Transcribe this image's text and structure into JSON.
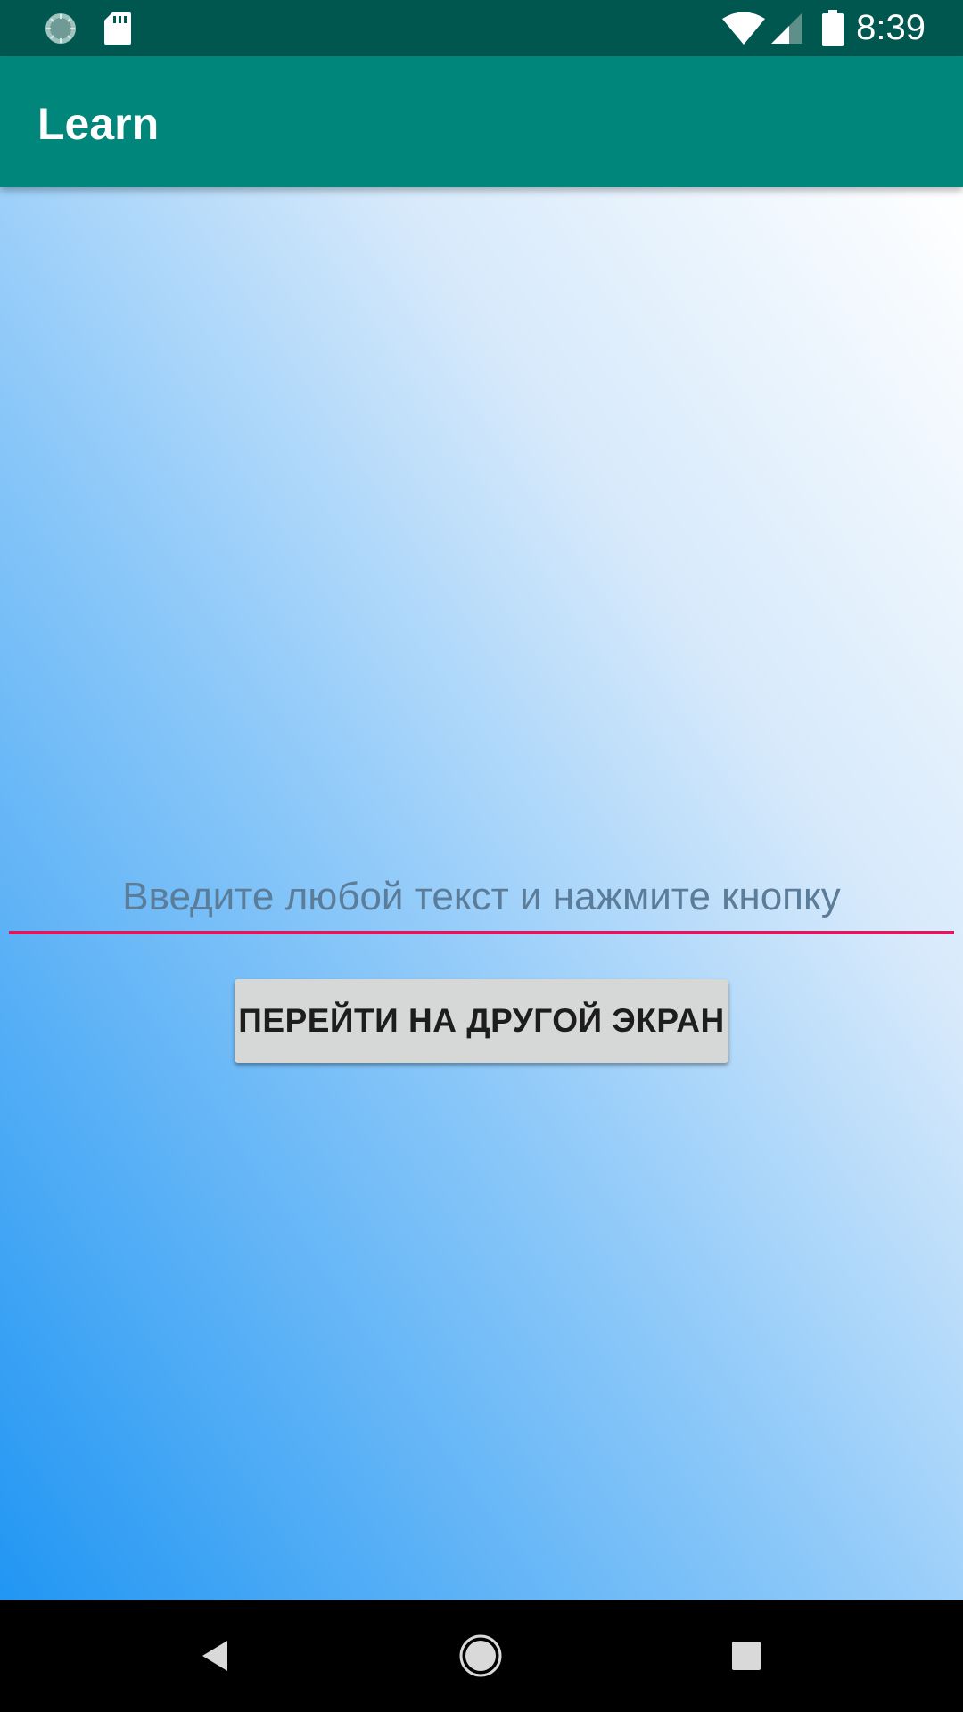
{
  "status_bar": {
    "time": "8:39",
    "left_icons": [
      "sync-icon",
      "sd-card-icon"
    ],
    "right_icons": [
      "wifi-icon",
      "cell-signal-icon",
      "battery-icon"
    ],
    "background": "#00574f"
  },
  "app_bar": {
    "title": "Learn",
    "background": "#00867a"
  },
  "main": {
    "input": {
      "value": "",
      "placeholder": "Введите любой текст и нажмите кнопку",
      "underline_color": "#d81b60"
    },
    "button_label": "ПЕРЕЙТИ НА ДРУГОЙ ЭКРАН",
    "gradient_colors": [
      "#2196f3",
      "#90caf9",
      "#ffffff"
    ]
  },
  "nav_bar": {
    "buttons": [
      "back-icon",
      "home-icon",
      "recents-icon"
    ]
  }
}
